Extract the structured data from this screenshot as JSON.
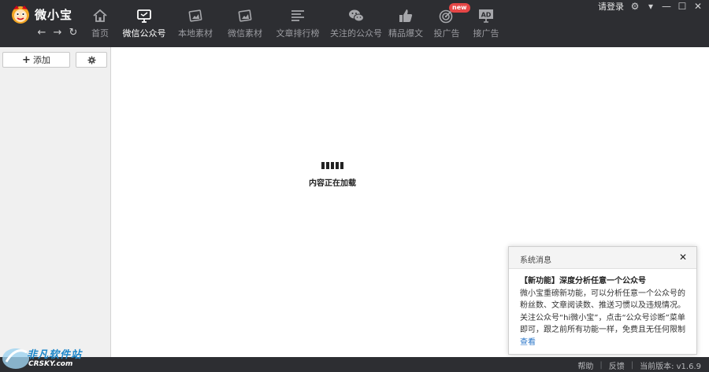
{
  "app": {
    "name": "微小宝",
    "login_label": "请登录"
  },
  "nav": {
    "back": "←",
    "forward": "→",
    "refresh": "↻"
  },
  "tabs": [
    {
      "label": "首页",
      "icon": "home-icon"
    },
    {
      "label": "微信公众号",
      "icon": "monitor-icon",
      "active": true
    },
    {
      "label": "本地素材",
      "icon": "images-icon"
    },
    {
      "label": "微信素材",
      "icon": "images-icon"
    },
    {
      "label": "文章排行榜",
      "icon": "list-icon"
    },
    {
      "label": "关注的公众号",
      "icon": "wechat-icon"
    },
    {
      "label": "精品爆文",
      "icon": "thumbs-up-icon"
    },
    {
      "label": "投广告",
      "icon": "target-icon",
      "badge": "new"
    },
    {
      "label": "接广告",
      "icon": "ad-icon",
      "icon_text": "AD"
    }
  ],
  "sidebar": {
    "add_label": "添加"
  },
  "main": {
    "loading_text": "内容正在加载"
  },
  "popup": {
    "title": "系统消息",
    "headline": "【新功能】深度分析任意一个公众号",
    "body": "微小宝重磅新功能，可以分析任意一个公众号的粉丝数、文章阅读数、推送习惯以及违规情况。关注公众号“hi微小宝”，点击“公众号诊断”菜单即可，跟之前所有功能一样，免费且无任何限制",
    "link_label": "查看"
  },
  "statusbar": {
    "help": "帮助",
    "feedback": "反馈",
    "version": "当前版本: v1.6.9"
  },
  "watermark": {
    "title": "非凡软件站",
    "subtitle": "CRSKY.com"
  },
  "colors": {
    "topbar": "#2d2e32",
    "accent_blue": "#2a76c8",
    "badge_red": "#e64646"
  }
}
